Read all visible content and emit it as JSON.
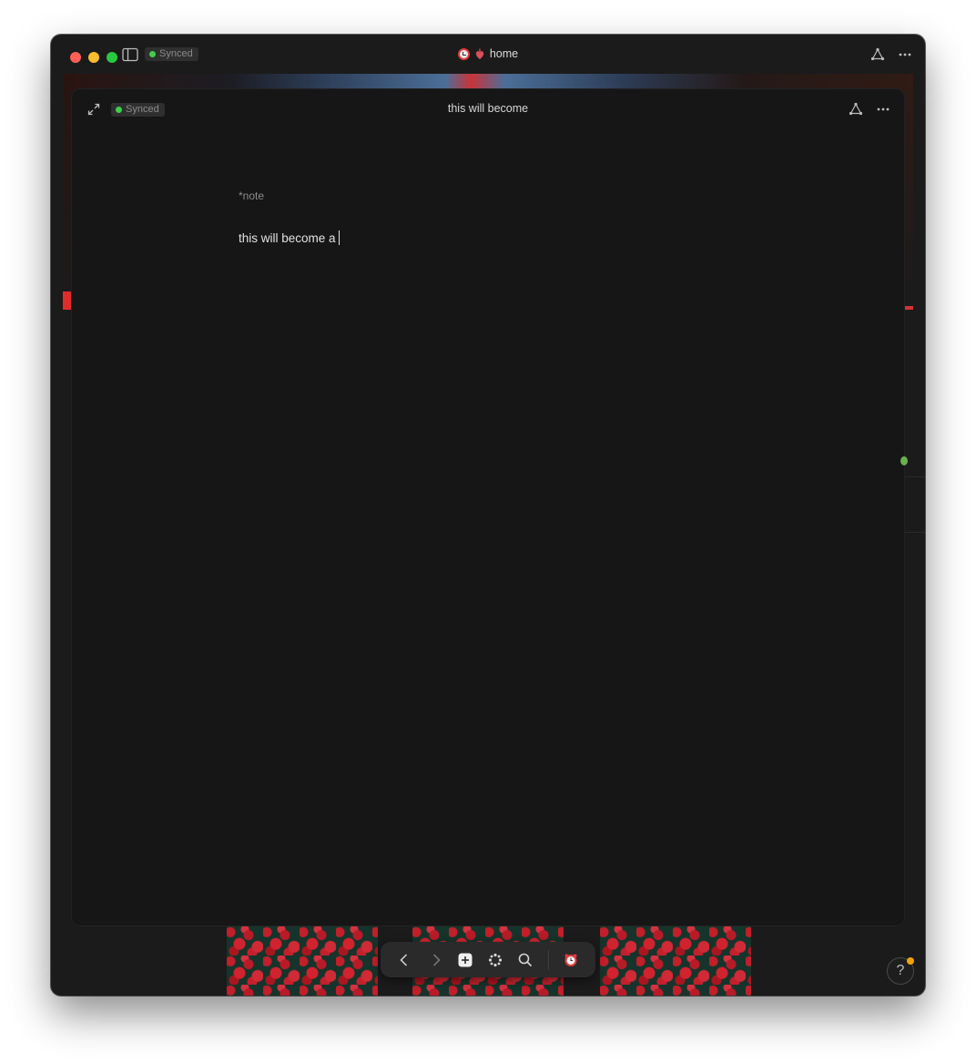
{
  "window": {
    "title": "home",
    "sync_status": "Synced"
  },
  "card": {
    "title": "this will become",
    "sync_status": "Synced",
    "note_tag": "*note",
    "body_text": "this will become a"
  },
  "help": {
    "label": "?"
  },
  "colors": {
    "synced_dot": "#3ecf4c",
    "notification_dot": "#f2a20d",
    "accent_red": "#e22b2b"
  },
  "icons": {
    "titlebar": [
      "sidebar-toggle-icon",
      "graph-icon",
      "more-icon"
    ],
    "card": [
      "expand-icon",
      "graph-icon",
      "more-icon"
    ],
    "dock": [
      "back-icon",
      "forward-icon",
      "new-note-icon",
      "command-icon",
      "search-icon",
      "workspace-icon"
    ]
  }
}
